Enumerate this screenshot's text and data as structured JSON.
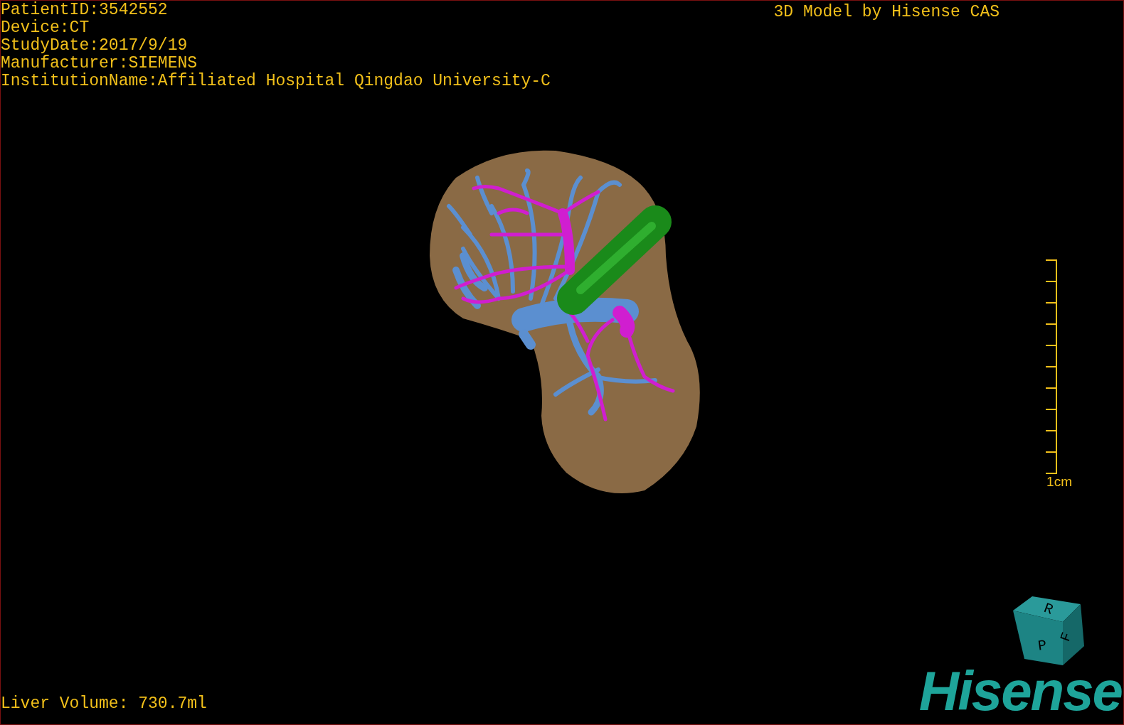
{
  "overlay": {
    "patient_info": [
      "PatientID:3542552",
      "Device:CT",
      "StudyDate:2017/9/19",
      "Manufacturer:SIEMENS",
      "InstitutionName:Affiliated Hospital Qingdao University-C"
    ],
    "title": "3D Model by Hisense CAS",
    "scale_bar": {
      "label": "1cm"
    },
    "volume": "Liver Volume: 730.7ml"
  },
  "orientation_cube": {
    "faces": [
      "R",
      "P",
      "F"
    ]
  },
  "logo": "Hisense"
}
